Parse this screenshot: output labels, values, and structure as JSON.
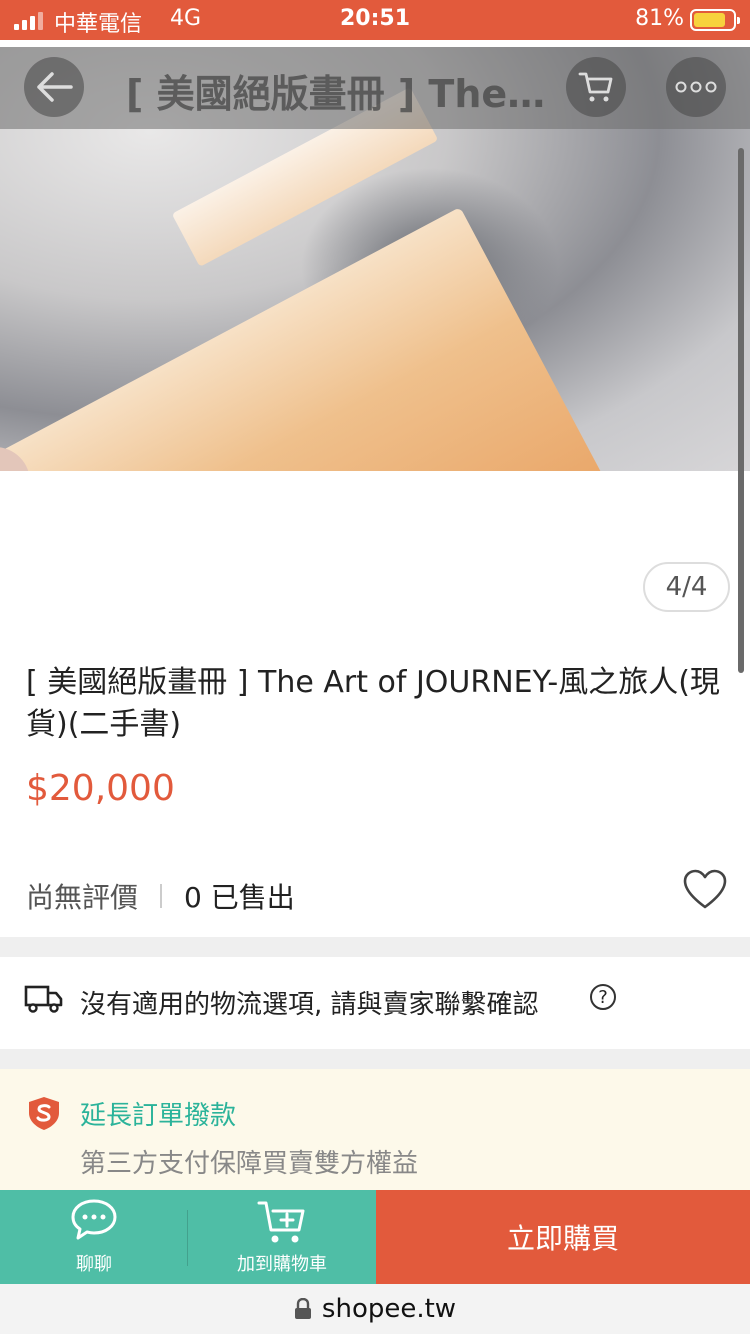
{
  "status_bar": {
    "carrier": "中華電信",
    "network": "4G",
    "time": "20:51",
    "battery": "81%",
    "battery_level": 0.81
  },
  "top_bar": {
    "title": "[ 美國絕版畫冊 ] The...",
    "icons": [
      "back-arrow-icon",
      "cart-icon",
      "more-icon"
    ]
  },
  "gallery": {
    "counter": "4/4"
  },
  "product": {
    "title": "[ 美國絕版畫冊 ] The Art of JOURNEY-風之旅人(現貨)(二手書)",
    "price": "$20,000",
    "rating_text": "尚無評價",
    "sold_text": "0 已售出"
  },
  "shipping": {
    "text": "沒有適用的物流選項, 請與賣家聯繫確認",
    "help": "?"
  },
  "guarantee": {
    "title": "延長訂單撥款",
    "subtitle": "第三方支付保障買賣雙方權益"
  },
  "actions": {
    "chat_label": "聊聊",
    "add_cart_label": "加到購物車",
    "buy_label": "立即購買"
  },
  "url_bar": {
    "url": "shopee.tw"
  },
  "colors": {
    "brand": "#e25a3c",
    "teal": "#4fbea6",
    "guarantee_text": "#2bb39a"
  }
}
